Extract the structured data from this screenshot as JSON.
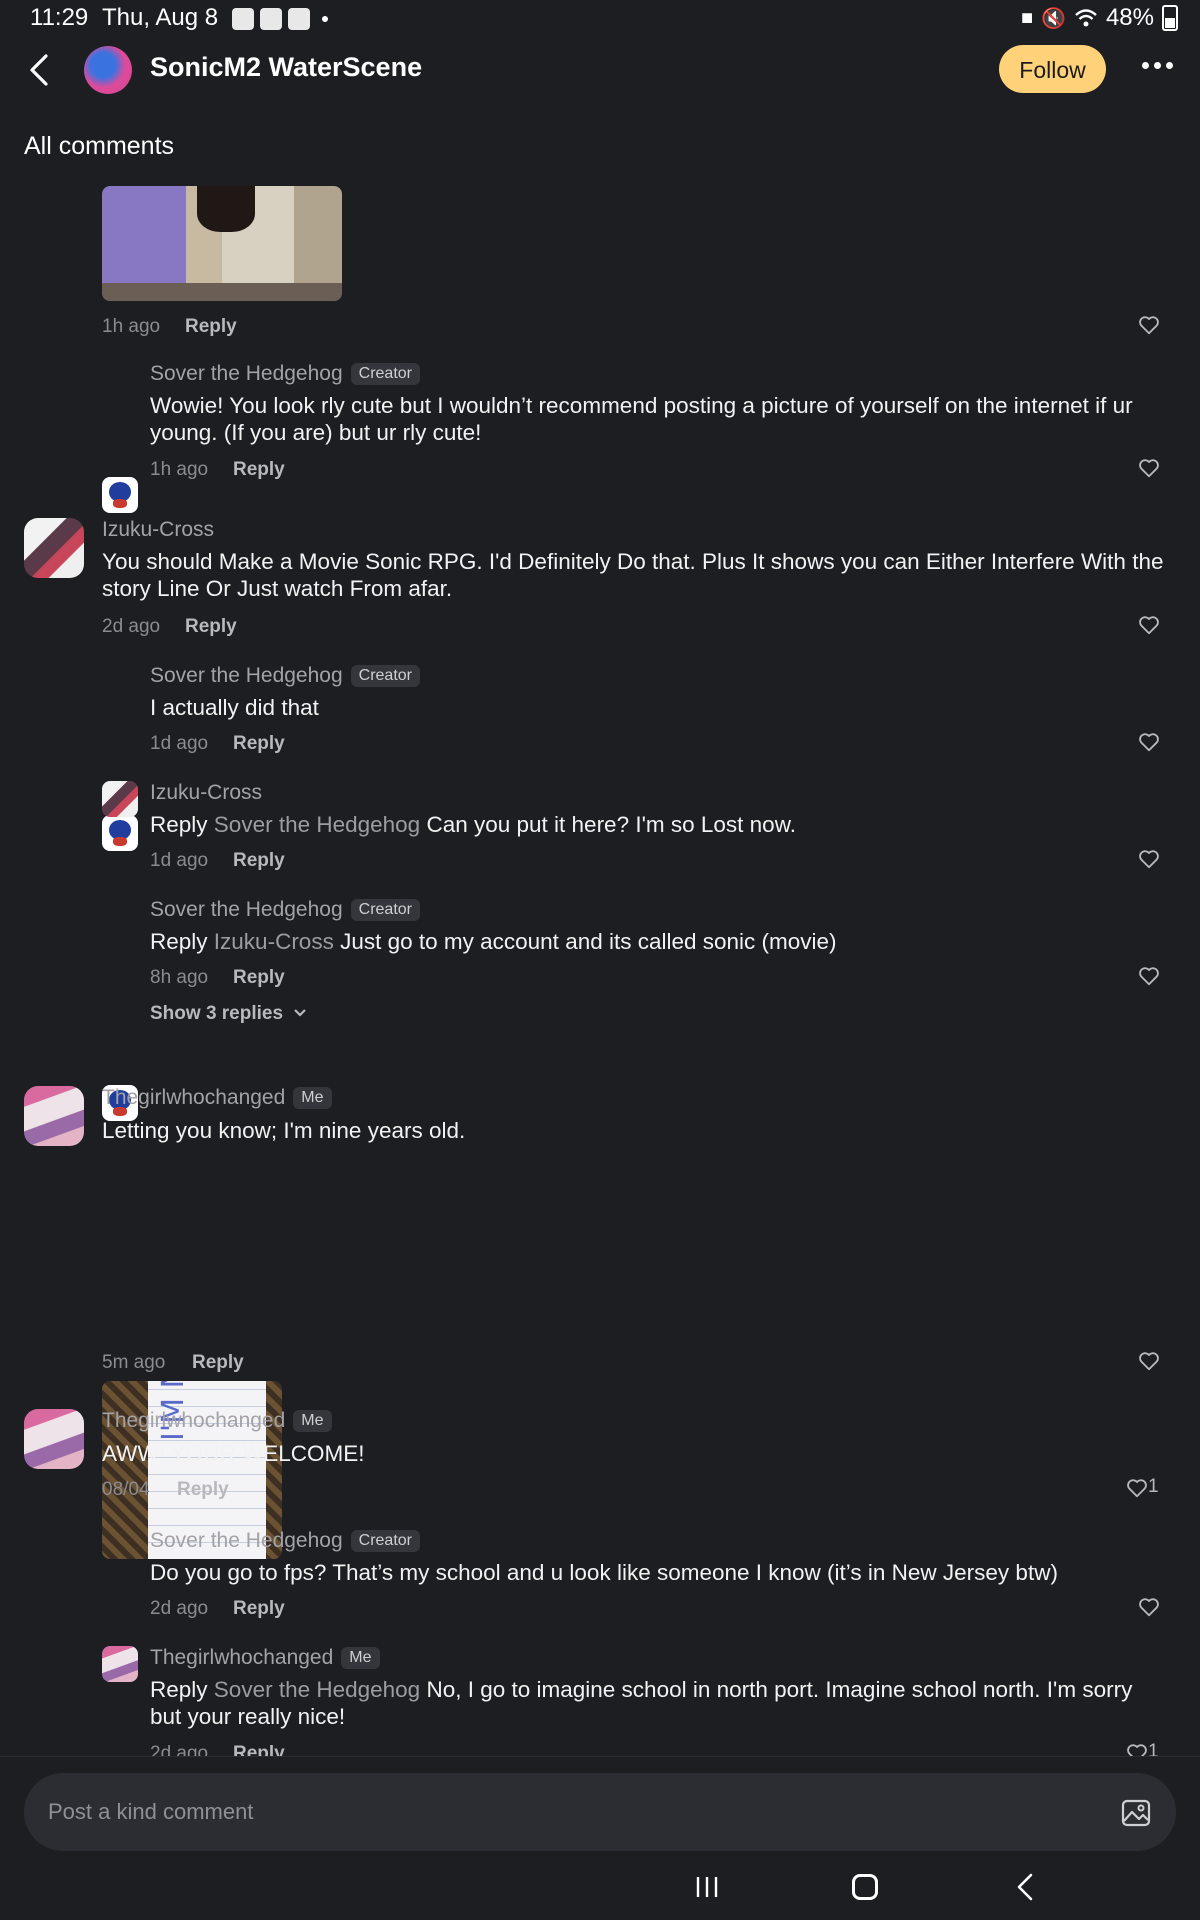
{
  "status_bar": {
    "time": "11:29",
    "date": "Thu, Aug 8",
    "battery": "48%"
  },
  "header": {
    "title": "SonicM2 WaterScene",
    "follow_label": "Follow"
  },
  "section_title": "All comments",
  "comments": {
    "c1": {
      "time": "1h ago",
      "reply": "Reply"
    },
    "c1r1": {
      "author": "Sover the Hedgehog",
      "badge": "Creator",
      "text": "Wowie! You look rly cute but I wouldn’t recommend posting a picture of yourself on the internet if ur young. (If you are) but ur rly cute!",
      "time": "1h ago",
      "reply": "Reply"
    },
    "c2": {
      "author": "Izuku-Cross",
      "text": "You should Make a Movie Sonic RPG.  I'd Definitely Do that. Plus It shows you can Either Interfere With the story Line Or Just watch From afar.",
      "time": "2d ago",
      "reply": "Reply"
    },
    "c2r1": {
      "author": "Sover the Hedgehog",
      "badge": "Creator",
      "text": "I actually did that",
      "time": "1d ago",
      "reply": "Reply"
    },
    "c2r2": {
      "author": "Izuku-Cross",
      "prefix": "Reply",
      "mention": "Sover the Hedgehog",
      "text": " Can you put it here? I'm so Lost now.",
      "time": "1d ago",
      "reply": "Reply"
    },
    "c2r3": {
      "author": "Sover the Hedgehog",
      "badge": "Creator",
      "prefix": "Reply",
      "mention": "Izuku-Cross",
      "text": " Just go to my account and its called sonic (movie)",
      "time": "8h ago",
      "reply": "Reply"
    },
    "c2_show_replies": "Show 3 replies",
    "c3": {
      "author": "Thegirlwhochanged",
      "badge": "Me",
      "text": "Letting you know; I'm nine years old.",
      "image_text": "I'M NINE!",
      "time": "5m ago",
      "reply": "Reply"
    },
    "c4": {
      "author": "Thegirlwhochanged",
      "badge": "Me",
      "text": "AWW! YOUR WELCOME!",
      "time": "08/04",
      "reply": "Reply",
      "likes": "1"
    },
    "c4r1": {
      "author": "Sover the Hedgehog",
      "badge": "Creator",
      "text": "Do you go to fps? That’s my school and u look like someone I know (it’s in New Jersey btw)",
      "time": "2d ago",
      "reply": "Reply"
    },
    "c4r2": {
      "author": "Thegirlwhochanged",
      "badge": "Me",
      "prefix": "Reply",
      "mention": "Sover the Hedgehog",
      "text": " No, I go to imagine school in north port. Imagine school  north. I'm sorry but your really nice!",
      "time": "2d ago",
      "reply": "Reply",
      "likes": "1"
    }
  },
  "composer": {
    "placeholder": "Post a kind comment"
  }
}
